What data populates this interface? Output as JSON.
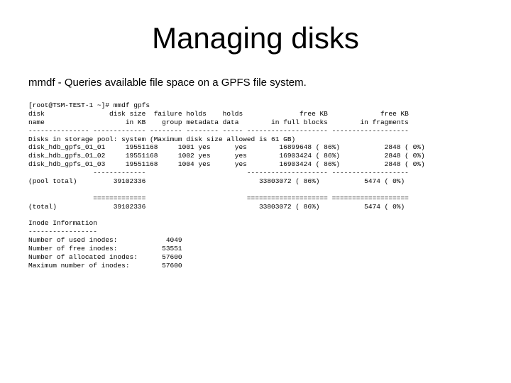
{
  "title": "Managing disks",
  "subtitle": "mmdf - Queries available file space on a GPFS file system.",
  "term": "[root@TSM-TEST-1 ~]# mmdf gpfs\ndisk                disk size  failure holds    holds              free KB             free KB\nname                    in KB    group metadata data        in full blocks        in fragments\n--------------- ------------- -------- -------- ----- -------------------- -------------------\nDisks in storage pool: system (Maximum disk size allowed is 61 GB)\ndisk_hdb_gpfs_01_01     19551168     1001 yes      yes        16899648 ( 86%)           2848 ( 0%)\ndisk_hdb_gpfs_01_02     19551168     1002 yes      yes        16903424 ( 86%)           2848 ( 0%)\ndisk_hdb_gpfs_01_03     19551168     1004 yes      yes        16903424 ( 86%)           2848 ( 0%)\n                -------------                         -------------------- -------------------\n(pool total)         39102336                            33803072 ( 86%)           5474 ( 0%)\n\n                =============                         ==================== ===================\n(total)              39102336                            33803072 ( 86%)           5474 ( 0%)\n\nInode Information\n-----------------\nNumber of used inodes:            4049\nNumber of free inodes:           53551\nNumber of allocated inodes:      57600\nMaximum number of inodes:        57600"
}
